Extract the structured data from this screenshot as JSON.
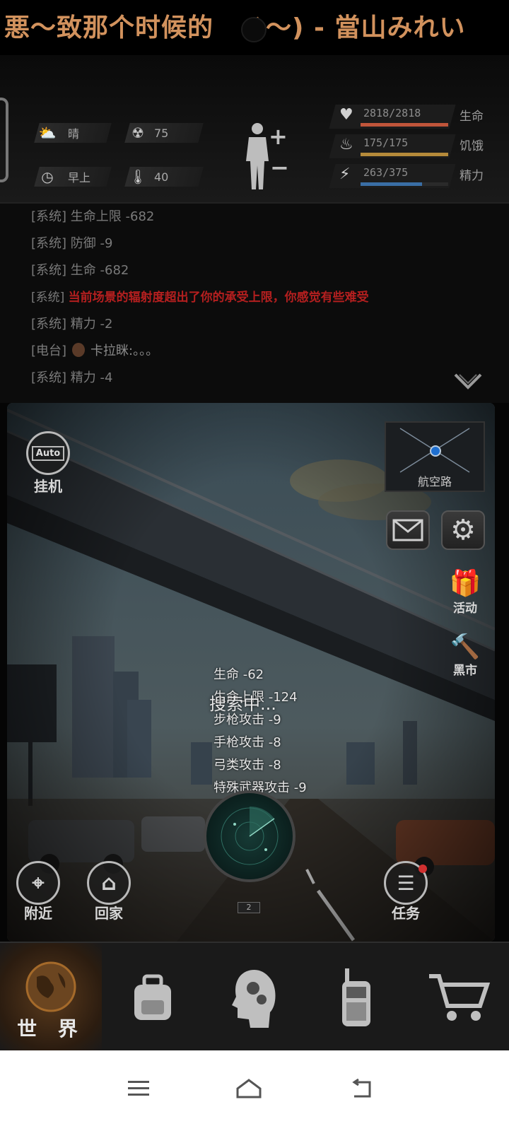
{
  "banner": {
    "text": "悪～致那个时候的　ゞ～) - 當山みれい"
  },
  "environment": {
    "weather_icon": "cloud-sun-icon",
    "weather": "晴",
    "radiation_icon": "radiation-icon",
    "radiation": "75",
    "time_icon": "clock-icon",
    "time": "早上",
    "temperature_icon": "thermometer-icon",
    "temperature": "40"
  },
  "vitals": [
    {
      "icon": "heart-icon",
      "value": "2818/2818",
      "label": "生命",
      "current": 2818,
      "max": 2818,
      "color": "#c0553a"
    },
    {
      "icon": "stomach-icon",
      "value": "175/175",
      "label": "饥饿",
      "current": 175,
      "max": 175,
      "color": "#b58a3a"
    },
    {
      "icon": "energy-icon",
      "value": "263/375",
      "label": "精力",
      "current": 263,
      "max": 375,
      "color": "#3a6ea5"
    }
  ],
  "log": {
    "lines": [
      {
        "tag": "[系统]",
        "msg": "生命上限 -682",
        "type": "normal"
      },
      {
        "tag": "[系统]",
        "msg": "防御 -9",
        "type": "normal"
      },
      {
        "tag": "[系统]",
        "msg": "生命 -682",
        "type": "normal"
      },
      {
        "tag": "[系统]",
        "msg": "当前场景的辐射度超出了你的承受上限，你感觉有些难受",
        "type": "alert"
      },
      {
        "tag": "[系统]",
        "msg": "精力 -2",
        "type": "normal"
      },
      {
        "tag": "[电台]",
        "msg": "卡拉眯:。。。",
        "type": "radio"
      },
      {
        "tag": "[系统]",
        "msg": "精力 -4",
        "type": "normal"
      }
    ]
  },
  "scene": {
    "auto_label": "挂机",
    "auto_badge": "Auto",
    "location": "航空路",
    "activity_label": "活动",
    "blackmarket_label": "黑市",
    "searching": "搜索中...",
    "floating": [
      "生命 -62",
      "生命上限 -124",
      "步枪攻击 -9",
      "手枪攻击 -8",
      "弓类攻击 -8",
      "特殊武器攻击 -9"
    ],
    "radar_badge": "2",
    "nearby_label": "附近",
    "home_label": "回家",
    "task_label": "任务"
  },
  "nav": {
    "world_label": "世 界"
  }
}
